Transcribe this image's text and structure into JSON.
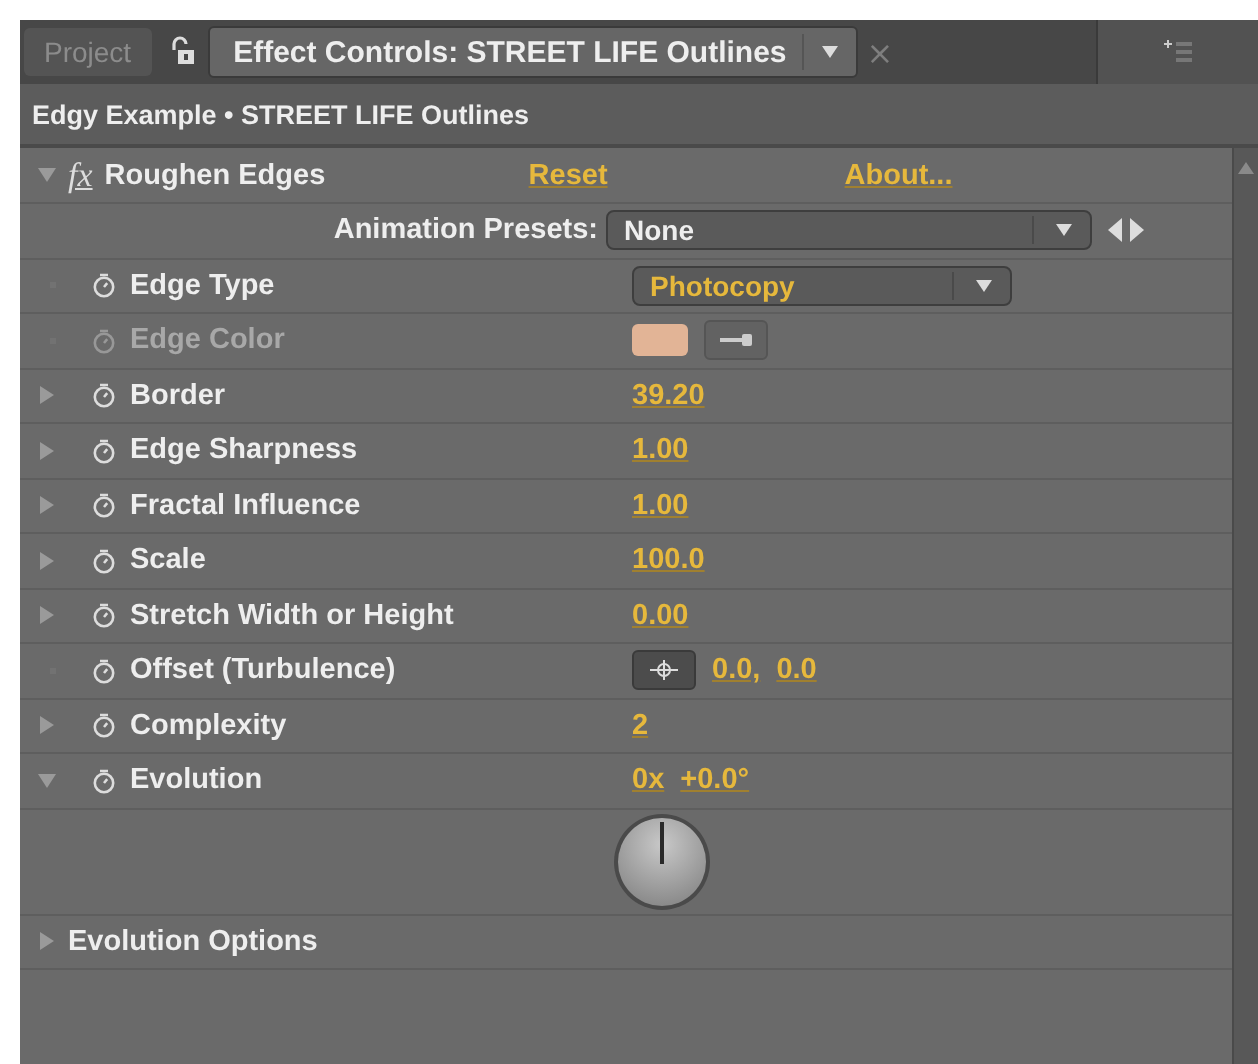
{
  "tabs": [
    {
      "label": "Project",
      "selected": false,
      "kind": "plain"
    },
    {
      "label": "Effect Controls: STREET LIFE Outlines",
      "selected": true,
      "kind": "menu",
      "close": "×"
    }
  ],
  "breadcrumb": "Edgy Example • STREET LIFE Outlines",
  "effect": {
    "badge": "fx",
    "name": "Roughen Edges",
    "expanded": true,
    "reset": "Reset",
    "about": "About..."
  },
  "rows": [
    {
      "kind": "preset",
      "label": "Animation Presets:",
      "value": "None"
    },
    {
      "kind": "menu",
      "label": "Edge Type",
      "value": "Photocopy",
      "disabled": false
    },
    {
      "kind": "color",
      "label": "Edge Color",
      "color": "#e2b496",
      "disabled": true
    },
    {
      "kind": "number",
      "label": "Border",
      "values": [
        "39.20"
      ],
      "expanded": false,
      "disabled": false
    },
    {
      "kind": "number",
      "label": "Edge Sharpness",
      "values": [
        "1.00"
      ],
      "expanded": false,
      "disabled": false
    },
    {
      "kind": "number",
      "label": "Fractal Influence",
      "values": [
        "1.00"
      ],
      "expanded": false,
      "disabled": false
    },
    {
      "kind": "number",
      "label": "Scale",
      "values": [
        "100.0"
      ],
      "expanded": false,
      "disabled": false
    },
    {
      "kind": "number",
      "label": "Stretch Width or Height",
      "values": [
        "0.00"
      ],
      "expanded": false,
      "disabled": false
    },
    {
      "kind": "point",
      "label": "Offset (Turbulence)",
      "values": [
        "0.0,",
        "0.0"
      ],
      "disabled": false
    },
    {
      "kind": "number",
      "label": "Complexity",
      "values": [
        "2"
      ],
      "expanded": false,
      "disabled": false
    },
    {
      "kind": "angle",
      "label": "Evolution",
      "values": [
        "0x",
        "+0.0°"
      ],
      "expanded": true,
      "disabled": false
    },
    {
      "kind": "group",
      "label": "Evolution Options",
      "expanded": false
    }
  ]
}
